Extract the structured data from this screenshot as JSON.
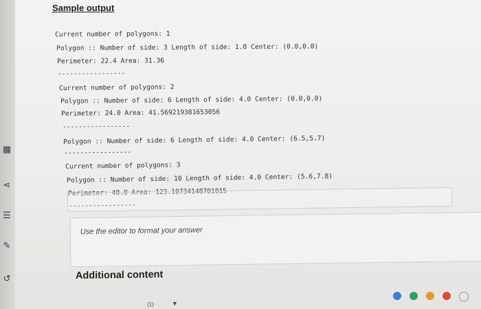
{
  "section": {
    "title": "Sample output"
  },
  "output_blocks": [
    {
      "lines": [
        "Current number of polygons: 1",
        "Polygon :: Number of side: 3 Length of side: 1.0 Center: (0.0,0.0)",
        "Perimeter: 22.4 Area: 31.36",
        "-----------------"
      ]
    },
    {
      "lines": [
        "Current number of polygons: 2",
        "Polygon :: Number of side: 6 Length of side: 4.0 Center: (0.0,0.0)",
        "Perimeter: 24.0 Area: 41.569219381653056",
        "-----------------"
      ]
    },
    {
      "lines": [
        "Polygon :: Number of side: 6 Length of side: 4.0 Center: (6.5,5.7)",
        "-----------------"
      ]
    },
    {
      "lines": [
        "Current number of polygons: 3",
        "Polygon :: Number of side: 10 Length of side: 4.0 Center: (5.6,7.8)",
        "Perimeter: 40.0 Area: 123.10734148701015",
        "-----------------"
      ]
    }
  ],
  "editor": {
    "placeholder": "Use the editor to format your answer"
  },
  "additional": {
    "title": "Additional content"
  },
  "dropdown": {
    "value": "(1)"
  },
  "icons": {
    "left_strip": [
      "grid-icon",
      "collapse-icon",
      "list-icon",
      "edit-icon",
      "undo-icon"
    ],
    "taskbar": [
      "app-icon-blue",
      "app-icon-green",
      "app-icon-orange",
      "app-icon-red"
    ]
  },
  "colors": {
    "background": "#eeedeb",
    "text": "#333333"
  }
}
